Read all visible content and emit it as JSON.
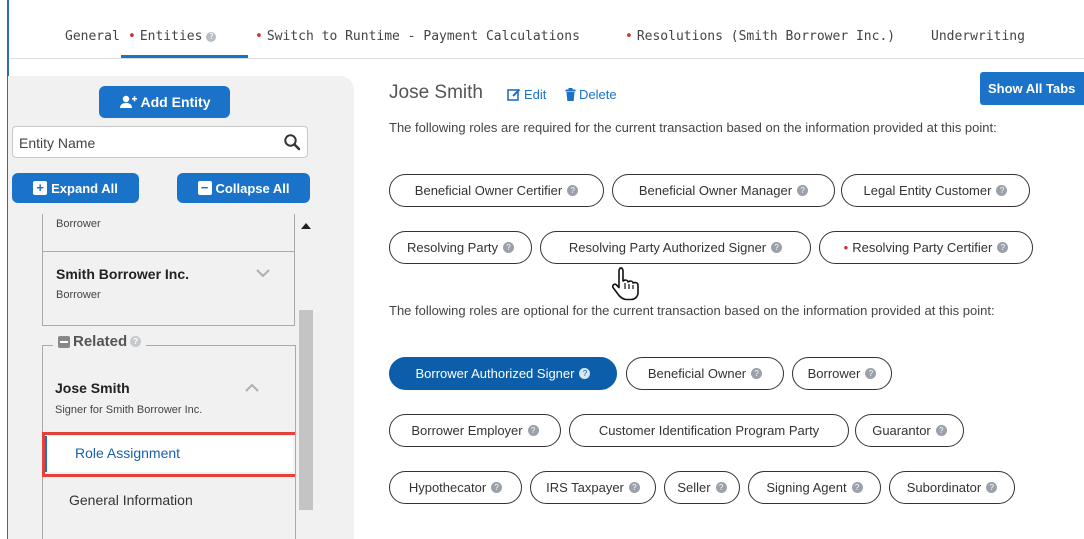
{
  "tabs": [
    {
      "label": "General",
      "required": false,
      "help": false
    },
    {
      "label": "Entities",
      "required": true,
      "help": true,
      "active": true
    },
    {
      "label": "Switch to Runtime - Payment Calculations",
      "required": true,
      "help": false
    },
    {
      "label": "Resolutions (Smith Borrower Inc.)",
      "required": true,
      "help": false
    },
    {
      "label": "Underwriting",
      "required": false,
      "help": false
    }
  ],
  "sidebar": {
    "add_entity": "Add Entity",
    "search_placeholder": "Entity Name",
    "expand_all": "Expand All",
    "collapse_all": "Collapse All",
    "partial_item_sub": "Borrower",
    "smith": {
      "name": "Smith Borrower Inc.",
      "sub": "Borrower"
    },
    "related_label": "Related",
    "jose": {
      "name": "Jose Smith",
      "sub": "Signer for Smith Borrower Inc."
    },
    "role_assignment": "Role Assignment",
    "general_information": "General Information"
  },
  "main": {
    "title": "Jose Smith",
    "edit": "Edit",
    "delete": "Delete",
    "show_all_tabs": "Show All Tabs",
    "required_text": "The following roles are required for the current transaction based on the information provided at this point:",
    "optional_text": "The following roles are optional for the current transaction based on the information provided at this point:",
    "required_roles": [
      {
        "label": "Beneficial Owner Certifier"
      },
      {
        "label": "Beneficial Owner Manager"
      },
      {
        "label": "Legal Entity Customer"
      },
      {
        "label": "Resolving Party"
      },
      {
        "label": "Resolving Party Authorized Signer"
      },
      {
        "label": "Resolving Party Certifier",
        "required_marker": true
      }
    ],
    "optional_roles": [
      {
        "label": "Borrower Authorized Signer",
        "selected": true
      },
      {
        "label": "Beneficial Owner"
      },
      {
        "label": "Borrower"
      },
      {
        "label": "Borrower Employer"
      },
      {
        "label": "Customer Identification Program Party"
      },
      {
        "label": "Guarantor"
      },
      {
        "label": "Hypothecator"
      },
      {
        "label": "IRS Taxpayer"
      },
      {
        "label": "Seller"
      },
      {
        "label": "Signing Agent"
      },
      {
        "label": "Subordinator"
      }
    ]
  },
  "colors": {
    "accent": "#1a73c8",
    "selected_pill": "#0c5eab",
    "required": "#d0312d",
    "highlight": "#e2423a"
  }
}
